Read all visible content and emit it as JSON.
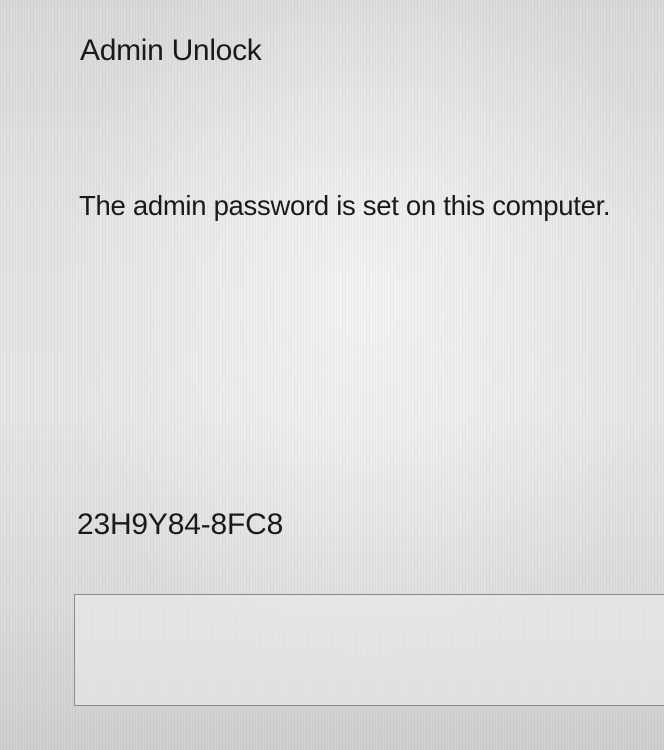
{
  "dialog": {
    "title": "Admin Unlock",
    "message": "The admin password is set on this computer.",
    "unlock_code": "23H9Y84-8FC8",
    "password_field": {
      "value": "",
      "placeholder": ""
    }
  }
}
